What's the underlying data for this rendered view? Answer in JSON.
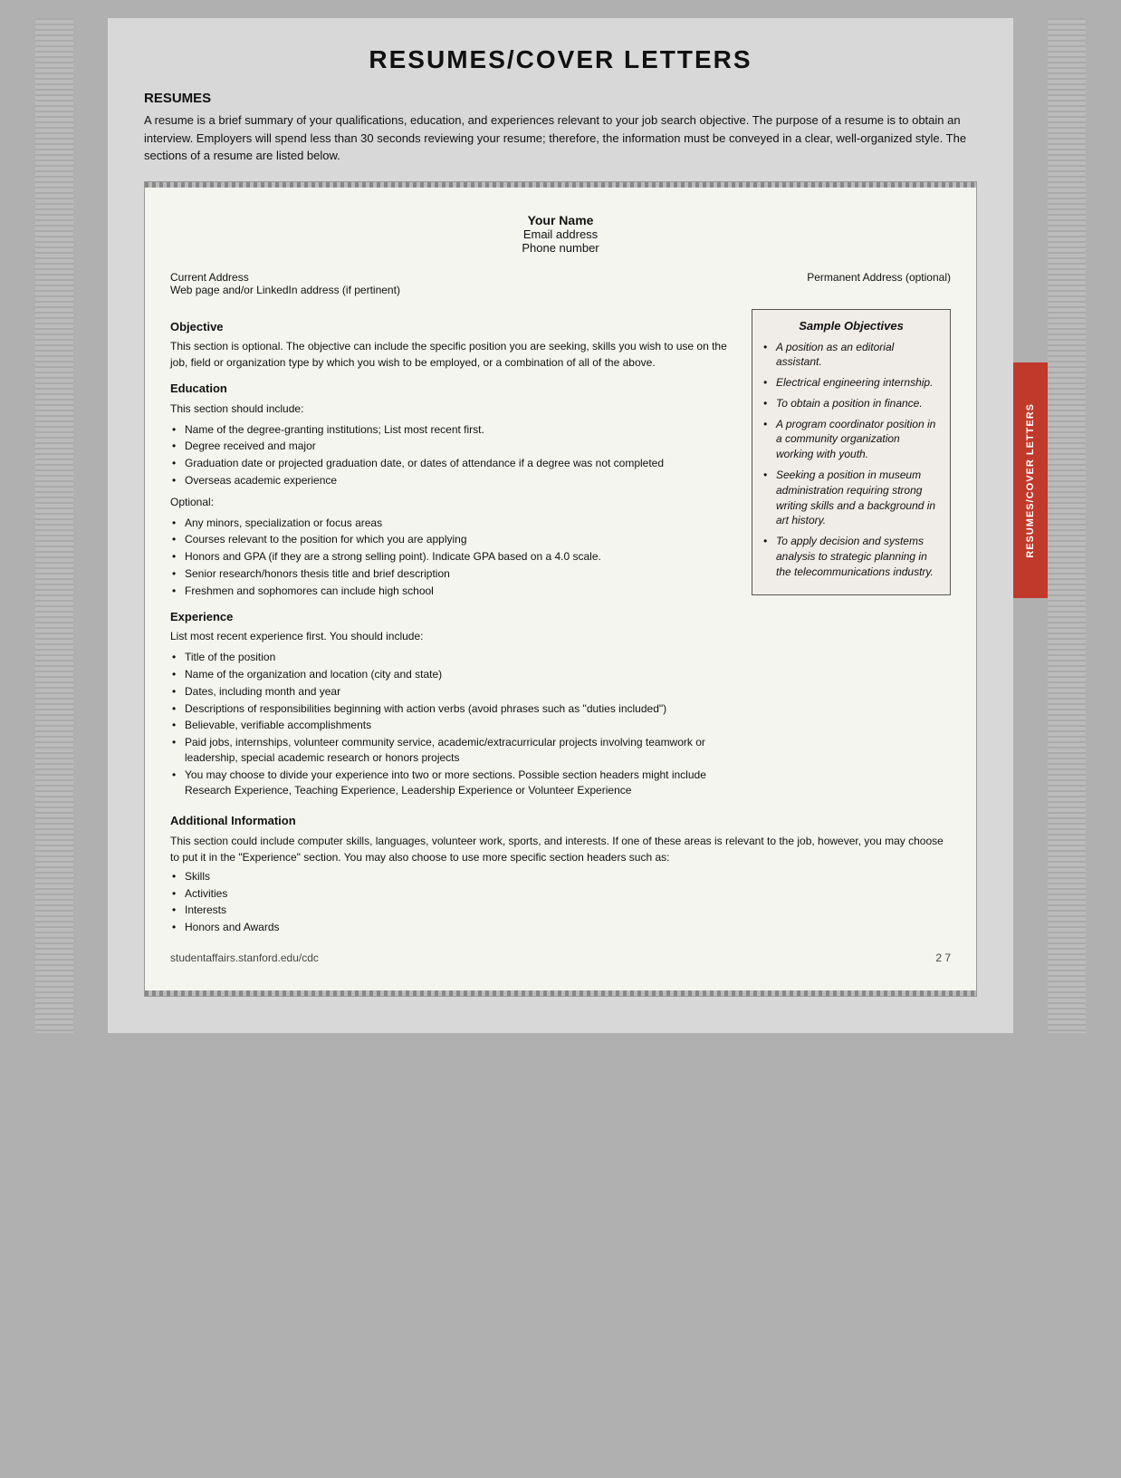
{
  "page": {
    "main_title": "RESUMES/COVER LETTERS",
    "section_heading": "RESUMES",
    "intro_text": "A resume is a brief summary of your qualifications, education, and experiences relevant to your job search objective. The purpose of a resume is to obtain an interview. Employers will spend less than 30 seconds reviewing your resume; therefore, the information must be conveyed in a clear, well-organized style. The sections of a resume are listed below.",
    "document": {
      "your_name": "Your Name",
      "email": "Email address",
      "phone": "Phone number",
      "current_address": "Current Address",
      "web_address": "Web page and/or LinkedIn address (if pertinent)",
      "permanent_address": "Permanent Address (optional)",
      "objective_title": "Objective",
      "objective_text": "This section is optional. The objective can include the specific position you are seeking, skills you wish to use on the job, field or organization type by which you wish to be employed, or a combination of all of the above.",
      "education_title": "Education",
      "education_intro": "This section should include:",
      "education_items": [
        "Name of the degree-granting institutions; List most recent first.",
        "Degree received and major",
        "Graduation date or projected graduation date, or dates of attendance if a degree was not completed",
        "Overseas academic experience"
      ],
      "education_optional": "Optional:",
      "education_optional_items": [
        "Any minors, specialization or focus areas",
        "Courses relevant to the position for which you are applying",
        "Honors and GPA (if they are a strong selling point). Indicate GPA based on a 4.0 scale.",
        "Senior research/honors thesis title and brief description",
        "Freshmen and sophomores can include high school"
      ],
      "experience_title": "Experience",
      "experience_intro": "List most recent experience first. You should include:",
      "experience_items": [
        "Title of the position",
        "Name of the organization and location (city and state)",
        "Dates, including month and year",
        "Descriptions of responsibilities beginning with action verbs (avoid phrases such as \"duties included\")",
        "Believable, verifiable accomplishments",
        "Paid jobs, internships, volunteer community service, academic/extracurricular projects involving teamwork or leadership, special academic research or honors projects",
        "You may choose to divide your experience into two or more sections. Possible section headers might include Research Experience, Teaching Experience, Leadership Experience or Volunteer Experience"
      ],
      "additional_title": "Additional Information",
      "additional_text": "This section could include computer skills, languages, volunteer work, sports, and interests. If one of these areas is relevant to the job, however, you may choose to put it in the \"Experience\" section. You may also choose to use more specific section headers such as:",
      "additional_items": [
        "Skills",
        "Activities",
        "Interests",
        "Honors and Awards"
      ]
    },
    "sample_objectives": {
      "title": "Sample Objectives",
      "items": [
        "A position as an editorial assistant.",
        "Electrical engineering internship.",
        "To obtain a position in finance.",
        "A program coordinator position in a community organization working with youth.",
        "Seeking a position in museum administration requiring strong writing skills and a background in art history.",
        "To apply decision and systems analysis to strategic planning in the telecommunications industry."
      ]
    },
    "footer": {
      "url": "studentaffairs.stanford.edu/cdc",
      "page": "2 7"
    },
    "side_tab": "RESUMES/COVER LETTERS"
  }
}
